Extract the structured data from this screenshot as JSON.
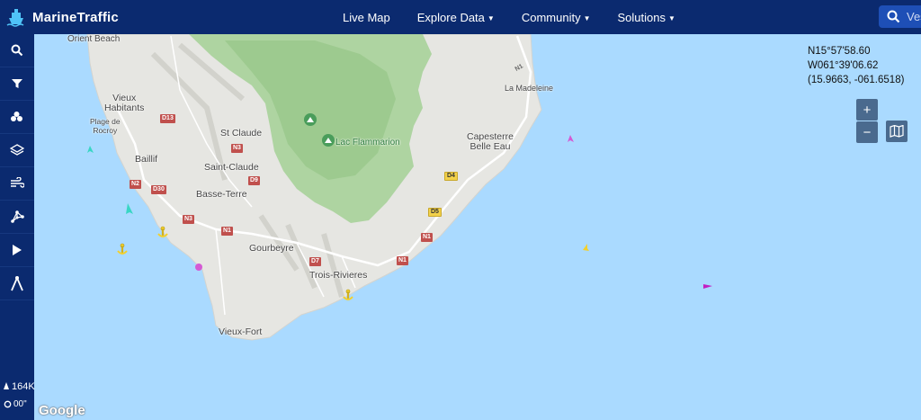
{
  "app": {
    "name": "MarineTraffic"
  },
  "nav": [
    {
      "label": "Live Map",
      "caret": false
    },
    {
      "label": "Explore Data",
      "caret": true
    },
    {
      "label": "Community",
      "caret": true
    },
    {
      "label": "Solutions",
      "caret": true
    }
  ],
  "search": {
    "placeholder": "Ves"
  },
  "sidebar": {
    "buttons": [
      "search-icon",
      "filter-icon",
      "fleet-icon",
      "layers-icon",
      "weather-icon",
      "density-icon",
      "play-icon",
      "measure-icon"
    ],
    "vessel_count": "164K",
    "speed": "00\""
  },
  "coords": {
    "lat": "N15°57'58.60",
    "lon": "W061°39'06.62",
    "decimal": "(15.9663, -061.6518)"
  },
  "zoom": {
    "in": "+",
    "out": "−"
  },
  "attribution": "Google",
  "colors": {
    "nav_bg": "#0b2a6f",
    "sea": "#aadaff",
    "land": "#e8e8e4",
    "park": "#a9d39b"
  },
  "places": [
    {
      "name": "Orient Beach",
      "type": "town"
    },
    {
      "name": "Vieux\nHabitants",
      "type": "town"
    },
    {
      "name": "Plage de\nRocroy",
      "type": "poi"
    },
    {
      "name": "Baillif",
      "type": "town"
    },
    {
      "name": "St Claude",
      "type": "town"
    },
    {
      "name": "Saint-Claude",
      "type": "town"
    },
    {
      "name": "Basse-Terre",
      "type": "town"
    },
    {
      "name": "Gourbeyre",
      "type": "town"
    },
    {
      "name": "Trois-Rivieres",
      "type": "town"
    },
    {
      "name": "Vieux-Fort",
      "type": "town"
    },
    {
      "name": "Capesterre\nBelle Eau",
      "type": "town"
    },
    {
      "name": "La Madeleine",
      "type": "town"
    },
    {
      "name": "Lac Flammarion",
      "type": "park"
    }
  ],
  "roads": [
    "D13",
    "N3",
    "D9",
    "N2",
    "D30",
    "N3",
    "N1",
    "D7",
    "N1",
    "N1",
    "D4",
    "D5",
    "N1"
  ]
}
